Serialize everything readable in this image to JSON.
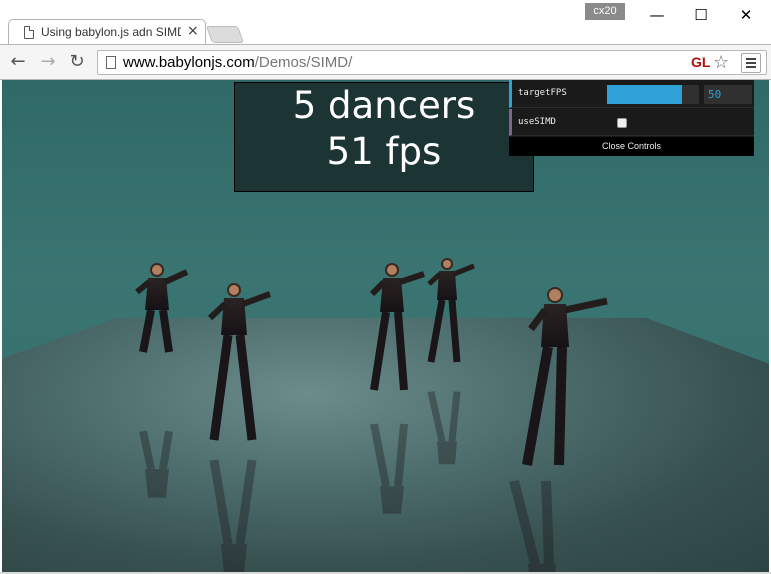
{
  "browser": {
    "tab_title": "Using babylon.js adn SIMD",
    "profile_badge": "cx20",
    "window_controls": {
      "minimize": "—",
      "maximize": "☐",
      "close": "✕"
    },
    "url_host": "www.babylonjs.com",
    "url_path": "/Demos/SIMD/",
    "gl_badge": "GL"
  },
  "stats": {
    "dancers": "5 dancers",
    "fps": "51 fps"
  },
  "controls": {
    "targetFPS_label": "targetFPS",
    "targetFPS_value": "50",
    "targetFPS_fraction": 0.82,
    "useSIMD_label": "useSIMD",
    "useSIMD_checked": false,
    "close_label": "Close Controls"
  },
  "colors": {
    "accent": "#2fa1d6",
    "scene_wall": "#356c6a"
  }
}
